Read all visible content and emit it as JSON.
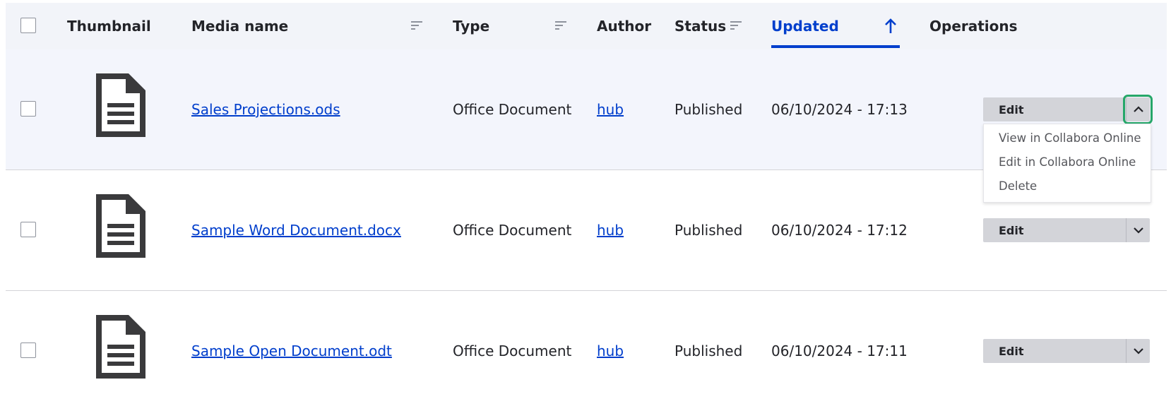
{
  "header": {
    "thumbnail": "Thumbnail",
    "media_name": "Media name",
    "type": "Type",
    "author": "Author",
    "status": "Status",
    "updated": "Updated",
    "operations": "Operations"
  },
  "rows": [
    {
      "name": "Sales Projections.ods",
      "type": "Office Document",
      "author": "hub",
      "status": "Published",
      "updated": "06/10/2024 - 17:13",
      "edit": "Edit"
    },
    {
      "name": "Sample Word Document.docx",
      "type": "Office Document",
      "author": "hub",
      "status": "Published",
      "updated": "06/10/2024 - 17:12",
      "edit": "Edit"
    },
    {
      "name": "Sample Open Document.odt",
      "type": "Office Document",
      "author": "hub",
      "status": "Published",
      "updated": "06/10/2024 - 17:11",
      "edit": "Edit"
    }
  ],
  "dropdown": {
    "items": [
      "View in Collabora Online",
      "Edit in Collabora Online",
      "Delete"
    ]
  },
  "colors": {
    "link": "#003ecc",
    "active_header": "#003ecc",
    "focus_ring": "#26a769"
  },
  "icons": {
    "sort": "sort-lines-icon",
    "sort_asc": "arrow-up-icon",
    "thumbnail": "document-icon",
    "toggle_open": "chevron-up-icon",
    "toggle_closed": "chevron-down-icon"
  }
}
